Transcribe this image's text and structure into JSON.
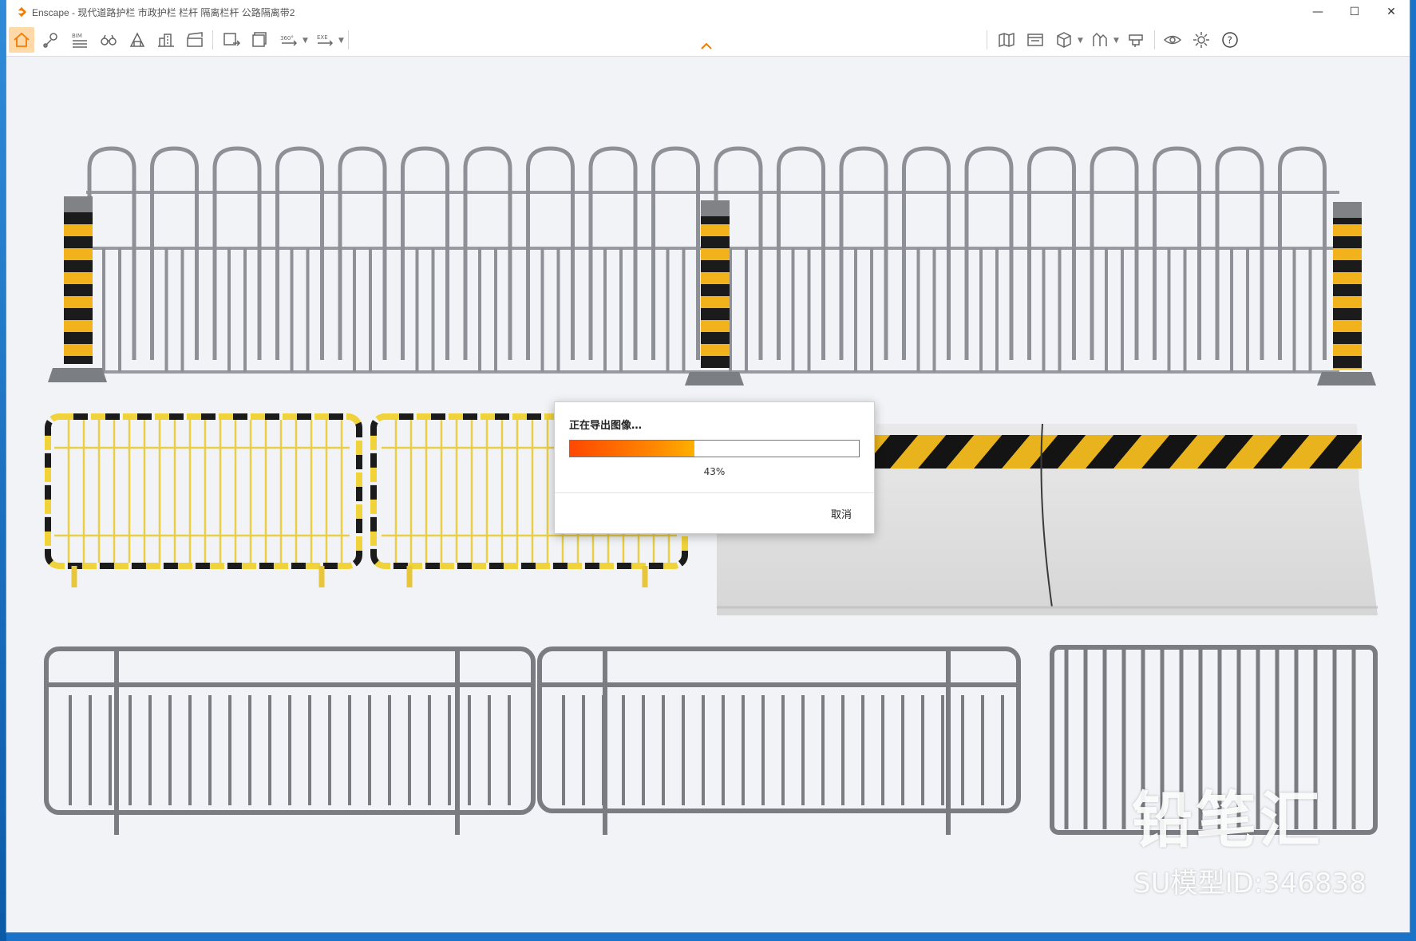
{
  "window": {
    "title": "Enscape - 现代道路护栏 市政护栏 栏杆 隔离栏杆 公路隔离带2",
    "controls": {
      "minimize": "—",
      "maximize": "☐",
      "close": "✕"
    }
  },
  "toolbar": {
    "left_icons": [
      "home-icon",
      "location-pin-icon",
      "bim-icon",
      "binoculars-icon",
      "asset-library-icon",
      "buildings-icon",
      "video-editor-icon",
      "screenshot-export-icon",
      "batch-export-icon",
      "panorama-360-icon",
      "exe-export-icon"
    ],
    "bim_label": "BIM",
    "pano_label": "360°",
    "exe_label": "EXE",
    "right_icons": [
      "map-icon",
      "views-icon",
      "cube-icon",
      "sync-icon",
      "materials-icon",
      "visual-settings-icon",
      "settings-icon",
      "help-icon"
    ]
  },
  "accent_color": "#f07c00",
  "export_dialog": {
    "title": "正在导出图像…",
    "progress_percent": 43,
    "progress_label": "43%",
    "cancel_label": "取消"
  },
  "watermark": {
    "brand": "铅笔汇",
    "model_id": "SU模型ID:346838"
  }
}
